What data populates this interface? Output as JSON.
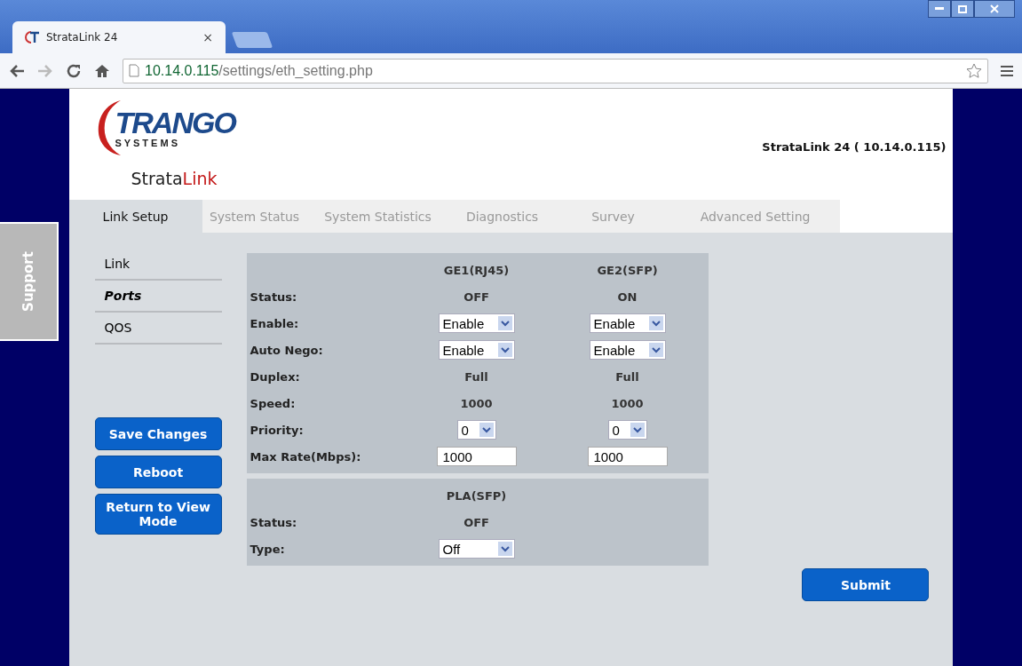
{
  "browser": {
    "tab_title": "StrataLink 24",
    "tab_close": "×",
    "url_host": "10.14.0.115",
    "url_path": "/settings/eth_setting.php"
  },
  "header": {
    "logo_main": "TRANGO",
    "logo_sub": "S Y S T E M S",
    "product_name": [
      {
        "text": "Strata",
        "accent": false
      },
      {
        "text": "Link",
        "accent": true
      }
    ],
    "device": "StrataLink 24 ( 10.14.0.115)"
  },
  "tabs": [
    {
      "label": "Link Setup",
      "selected": true
    },
    {
      "label": "System Status",
      "selected": false
    },
    {
      "label": "System Statistics",
      "selected": false
    },
    {
      "label": "Diagnostics",
      "selected": false
    },
    {
      "label": "Survey",
      "selected": false
    },
    {
      "label": "Advanced Setting",
      "selected": false
    }
  ],
  "support_tab": "Support",
  "sidebar": {
    "items": [
      {
        "label": "Link",
        "selected": false
      },
      {
        "label": "Ports",
        "selected": true
      },
      {
        "label": "QOS",
        "selected": false
      }
    ],
    "buttons": [
      "Save Changes",
      "Reboot",
      "Return to View Mode"
    ]
  },
  "ports": {
    "columns": [
      "GE1(RJ45)",
      "GE2(SFP)"
    ],
    "rows": [
      {
        "label": "Status:",
        "kind": "text",
        "values": [
          "OFF",
          "ON"
        ]
      },
      {
        "label": "Enable:",
        "kind": "select",
        "values": [
          "Enable",
          "Enable"
        ]
      },
      {
        "label": "Auto Nego:",
        "kind": "select",
        "values": [
          "Enable",
          "Enable"
        ]
      },
      {
        "label": "Duplex:",
        "kind": "text",
        "values": [
          "Full",
          "Full"
        ]
      },
      {
        "label": "Speed:",
        "kind": "text",
        "values": [
          "1000",
          "1000"
        ]
      },
      {
        "label": "Priority:",
        "kind": "small-select",
        "values": [
          "0",
          "0"
        ]
      },
      {
        "label": "Max Rate(Mbps):",
        "kind": "input",
        "values": [
          "1000",
          "1000"
        ]
      }
    ]
  },
  "pla": {
    "columns": [
      "PLA(SFP)"
    ],
    "rows": [
      {
        "label": "Status:",
        "kind": "text",
        "values": [
          "OFF"
        ]
      },
      {
        "label": "Type:",
        "kind": "select",
        "values": [
          "Off"
        ]
      }
    ]
  },
  "submit": "Submit"
}
